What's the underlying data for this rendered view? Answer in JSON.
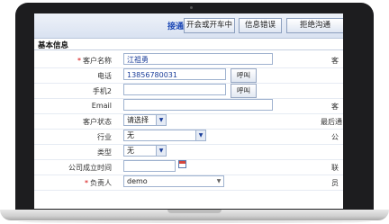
{
  "toolbar": {
    "quick_label": "接通：",
    "buttons": [
      "开会或开车中",
      "信息错误",
      "拒绝沟通"
    ]
  },
  "section_title": "基本信息",
  "call_label": "呼叫",
  "fields": {
    "customer_name": {
      "label": "客户名称",
      "value": "江祖勇",
      "required": true
    },
    "phone": {
      "label": "电话",
      "value": "13856780031"
    },
    "mobile2": {
      "label": "手机2",
      "value": ""
    },
    "email": {
      "label": "Email",
      "value": ""
    },
    "status": {
      "label": "客户状态",
      "value": "请选择"
    },
    "industry": {
      "label": "行业",
      "value": "无"
    },
    "type": {
      "label": "类型",
      "value": "无"
    },
    "founded": {
      "label": "公司成立时间",
      "value": ""
    },
    "owner": {
      "label": "负责人",
      "value": "demo",
      "required": true
    }
  },
  "right_labels": [
    "客",
    "客",
    "最后通",
    "公",
    "联",
    "员"
  ],
  "required_mark": "*",
  "colors": {
    "accent": "#1a46b5",
    "required": "#d40000",
    "toolbar_bg": "#dfe6f2"
  }
}
